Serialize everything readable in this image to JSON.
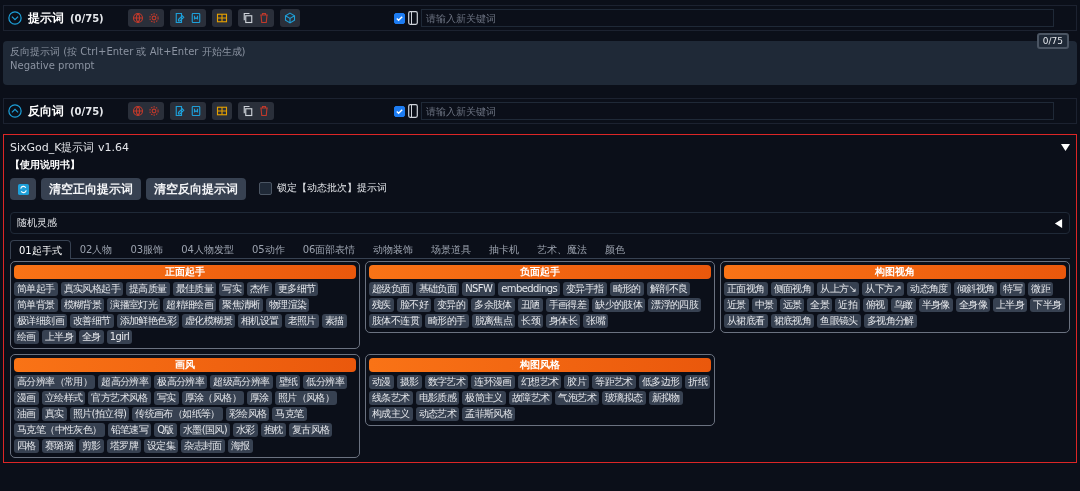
{
  "prompt_rows": [
    {
      "title": "提示词",
      "count": "(0/75)",
      "expanded": true,
      "extra_tool": true,
      "checked": true,
      "placeholder": "请输入新关键词"
    },
    {
      "title": "反向词",
      "count": "(0/75)",
      "expanded": false,
      "extra_tool": false,
      "checked": true,
      "placeholder": "请输入新关键词"
    }
  ],
  "negative_prompt": {
    "placeholder": "反向提示词 (按 Ctrl+Enter 或 Alt+Enter 开始生成)\nNegative prompt",
    "counter": "0/75"
  },
  "extension": {
    "title": "SixGod_K提示词 v1.64",
    "expanded": true,
    "manual_link": "【使用说明书】",
    "buttons": [
      "清空正向提示词",
      "清空反向提示词"
    ],
    "lock_checkbox": {
      "label": "锁定【动态批次】提示词",
      "checked": false
    },
    "accordion": {
      "title": "随机灵感",
      "expanded": false
    },
    "tabs": [
      {
        "label": "01起手式",
        "selected": true
      },
      {
        "label": "02人物",
        "selected": false
      },
      {
        "label": "03服饰",
        "selected": false
      },
      {
        "label": "04人物发型",
        "selected": false
      },
      {
        "label": "05动作",
        "selected": false
      },
      {
        "label": "06面部表情",
        "selected": false
      },
      {
        "label": "动物装饰",
        "selected": false
      },
      {
        "label": "场景道具",
        "selected": false
      },
      {
        "label": "抽卡机",
        "selected": false
      },
      {
        "label": "艺术、魔法",
        "selected": false
      },
      {
        "label": "颜色",
        "selected": false
      }
    ],
    "panels": [
      {
        "title": "正面起手",
        "tags": [
          "简单起手",
          "真实风格起手",
          "提高质量",
          "最佳质量",
          "写实",
          "杰作",
          "更多细节",
          "简单背景",
          "模糊背景",
          "演播室灯光",
          "超精细绘画",
          "聚焦清晰",
          "物理渲染",
          "极详细刻画",
          "改善细节",
          "添加鲜艳色彩",
          "虚化模糊景",
          "相机设置",
          "老照片",
          "素描",
          "绘画",
          "上半身",
          "全身",
          "1girl"
        ]
      },
      {
        "title": "负面起手",
        "tags": [
          "超级负面",
          "基础负面",
          "NSFW",
          "embeddings",
          "变异手指",
          "畸形的",
          "解剖不良",
          "残疾",
          "脸不好",
          "变异的",
          "多余肢体",
          "丑陋",
          "手画得差",
          "缺少的肢体",
          "漂浮的四肢",
          "肢体不连贯",
          "畸形的手",
          "脱离焦点",
          "长颈",
          "身体长",
          "张嘴"
        ]
      },
      {
        "title": "构图视角",
        "tags": [
          "正面视角",
          "侧面视角",
          "从上方↘",
          "从下方↗",
          "动态角度",
          "倾斜视角",
          "特写",
          "微距",
          "近景",
          "中景",
          "远景",
          "全景",
          "近拍",
          "俯视",
          "鸟瞰",
          "半身像",
          "全身像",
          "上半身",
          "下半身",
          "从裙底看",
          "裙底视角",
          "鱼眼镜头",
          "多视角分解"
        ]
      },
      {
        "title": "画风",
        "tags": [
          "高分辨率（常用）",
          "超高分辨率",
          "极高分辨率",
          "超级高分辨率",
          "壁纸",
          "低分辨率",
          "漫画",
          "立绘样式",
          "官方艺术风格",
          "写实",
          "厚涂（风格）",
          "厚涂",
          "照片（风格）",
          "油画",
          "真实",
          "照片(拍立得)",
          "传统画布（如纸等）",
          "彩绘风格",
          "马克笔",
          "马克笔（中性灰色）",
          "铅笔速写",
          "Q版",
          "水墨(国风)",
          "水彩",
          "抱枕",
          "复古风格",
          "四格",
          "赛璐璐",
          "剪影",
          "塔罗牌",
          "设定集",
          "杂志封面",
          "海报"
        ]
      },
      {
        "title": "构图风格",
        "tags": [
          "动漫",
          "摄影",
          "数字艺术",
          "连环漫画",
          "幻想艺术",
          "胶片",
          "等距艺术",
          "低多边形",
          "折纸",
          "线条艺术",
          "电影质感",
          "极简主义",
          "故障艺术",
          "气泡艺术",
          "玻璃拟态",
          "新拟物",
          "构成主义",
          "动态艺术",
          "孟菲斯风格"
        ]
      }
    ]
  }
}
